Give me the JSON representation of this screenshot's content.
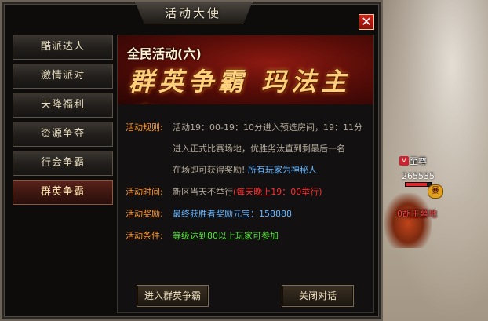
{
  "dialog": {
    "title": "活动大使",
    "close_icon": "close-icon"
  },
  "sidebar": {
    "items": [
      {
        "label": "酷派达人",
        "active": false
      },
      {
        "label": "激情派对",
        "active": false
      },
      {
        "label": "天降福利",
        "active": false
      },
      {
        "label": "资源争夺",
        "active": false
      },
      {
        "label": "行会争霸",
        "active": false
      },
      {
        "label": "群英争霸",
        "active": true
      }
    ]
  },
  "banner": {
    "subtitle": "全民活动(六)",
    "title": "群英争霸 玛法主宰"
  },
  "info": {
    "rules_label": "活动规则:",
    "rules_line1": "活动19：00-19：10分进入预选房间，19：11分",
    "rules_line2": "进入正式比赛场地，优胜劣汰直到剩最后一名",
    "rules_line3a": "在场即可获得奖励!",
    "rules_line3b": "所有玩家为神秘人",
    "time_label": "活动时间:",
    "time_text": "新区当天不举行",
    "time_highlight": "(每天晚上19：00举行)",
    "reward_label": "活动奖励:",
    "reward_text": "最终获胜者奖励元宝：158888",
    "condition_label": "活动条件:",
    "condition_text": "等级达到80以上玩家可参加"
  },
  "buttons": {
    "enter_label": "进入群英争霸",
    "close_label": "关闭对话"
  },
  "player": {
    "rank_icon": "V",
    "name": "至尊",
    "hp": "265535",
    "badge": "暴",
    "guild": "0胡王墓地",
    "hp_fraction": 0.85
  },
  "colors": {
    "label_orange": "#ff9a30",
    "highlight_blue": "#67b6ff",
    "highlight_red": "#ff3030",
    "highlight_green": "#55e23a"
  }
}
